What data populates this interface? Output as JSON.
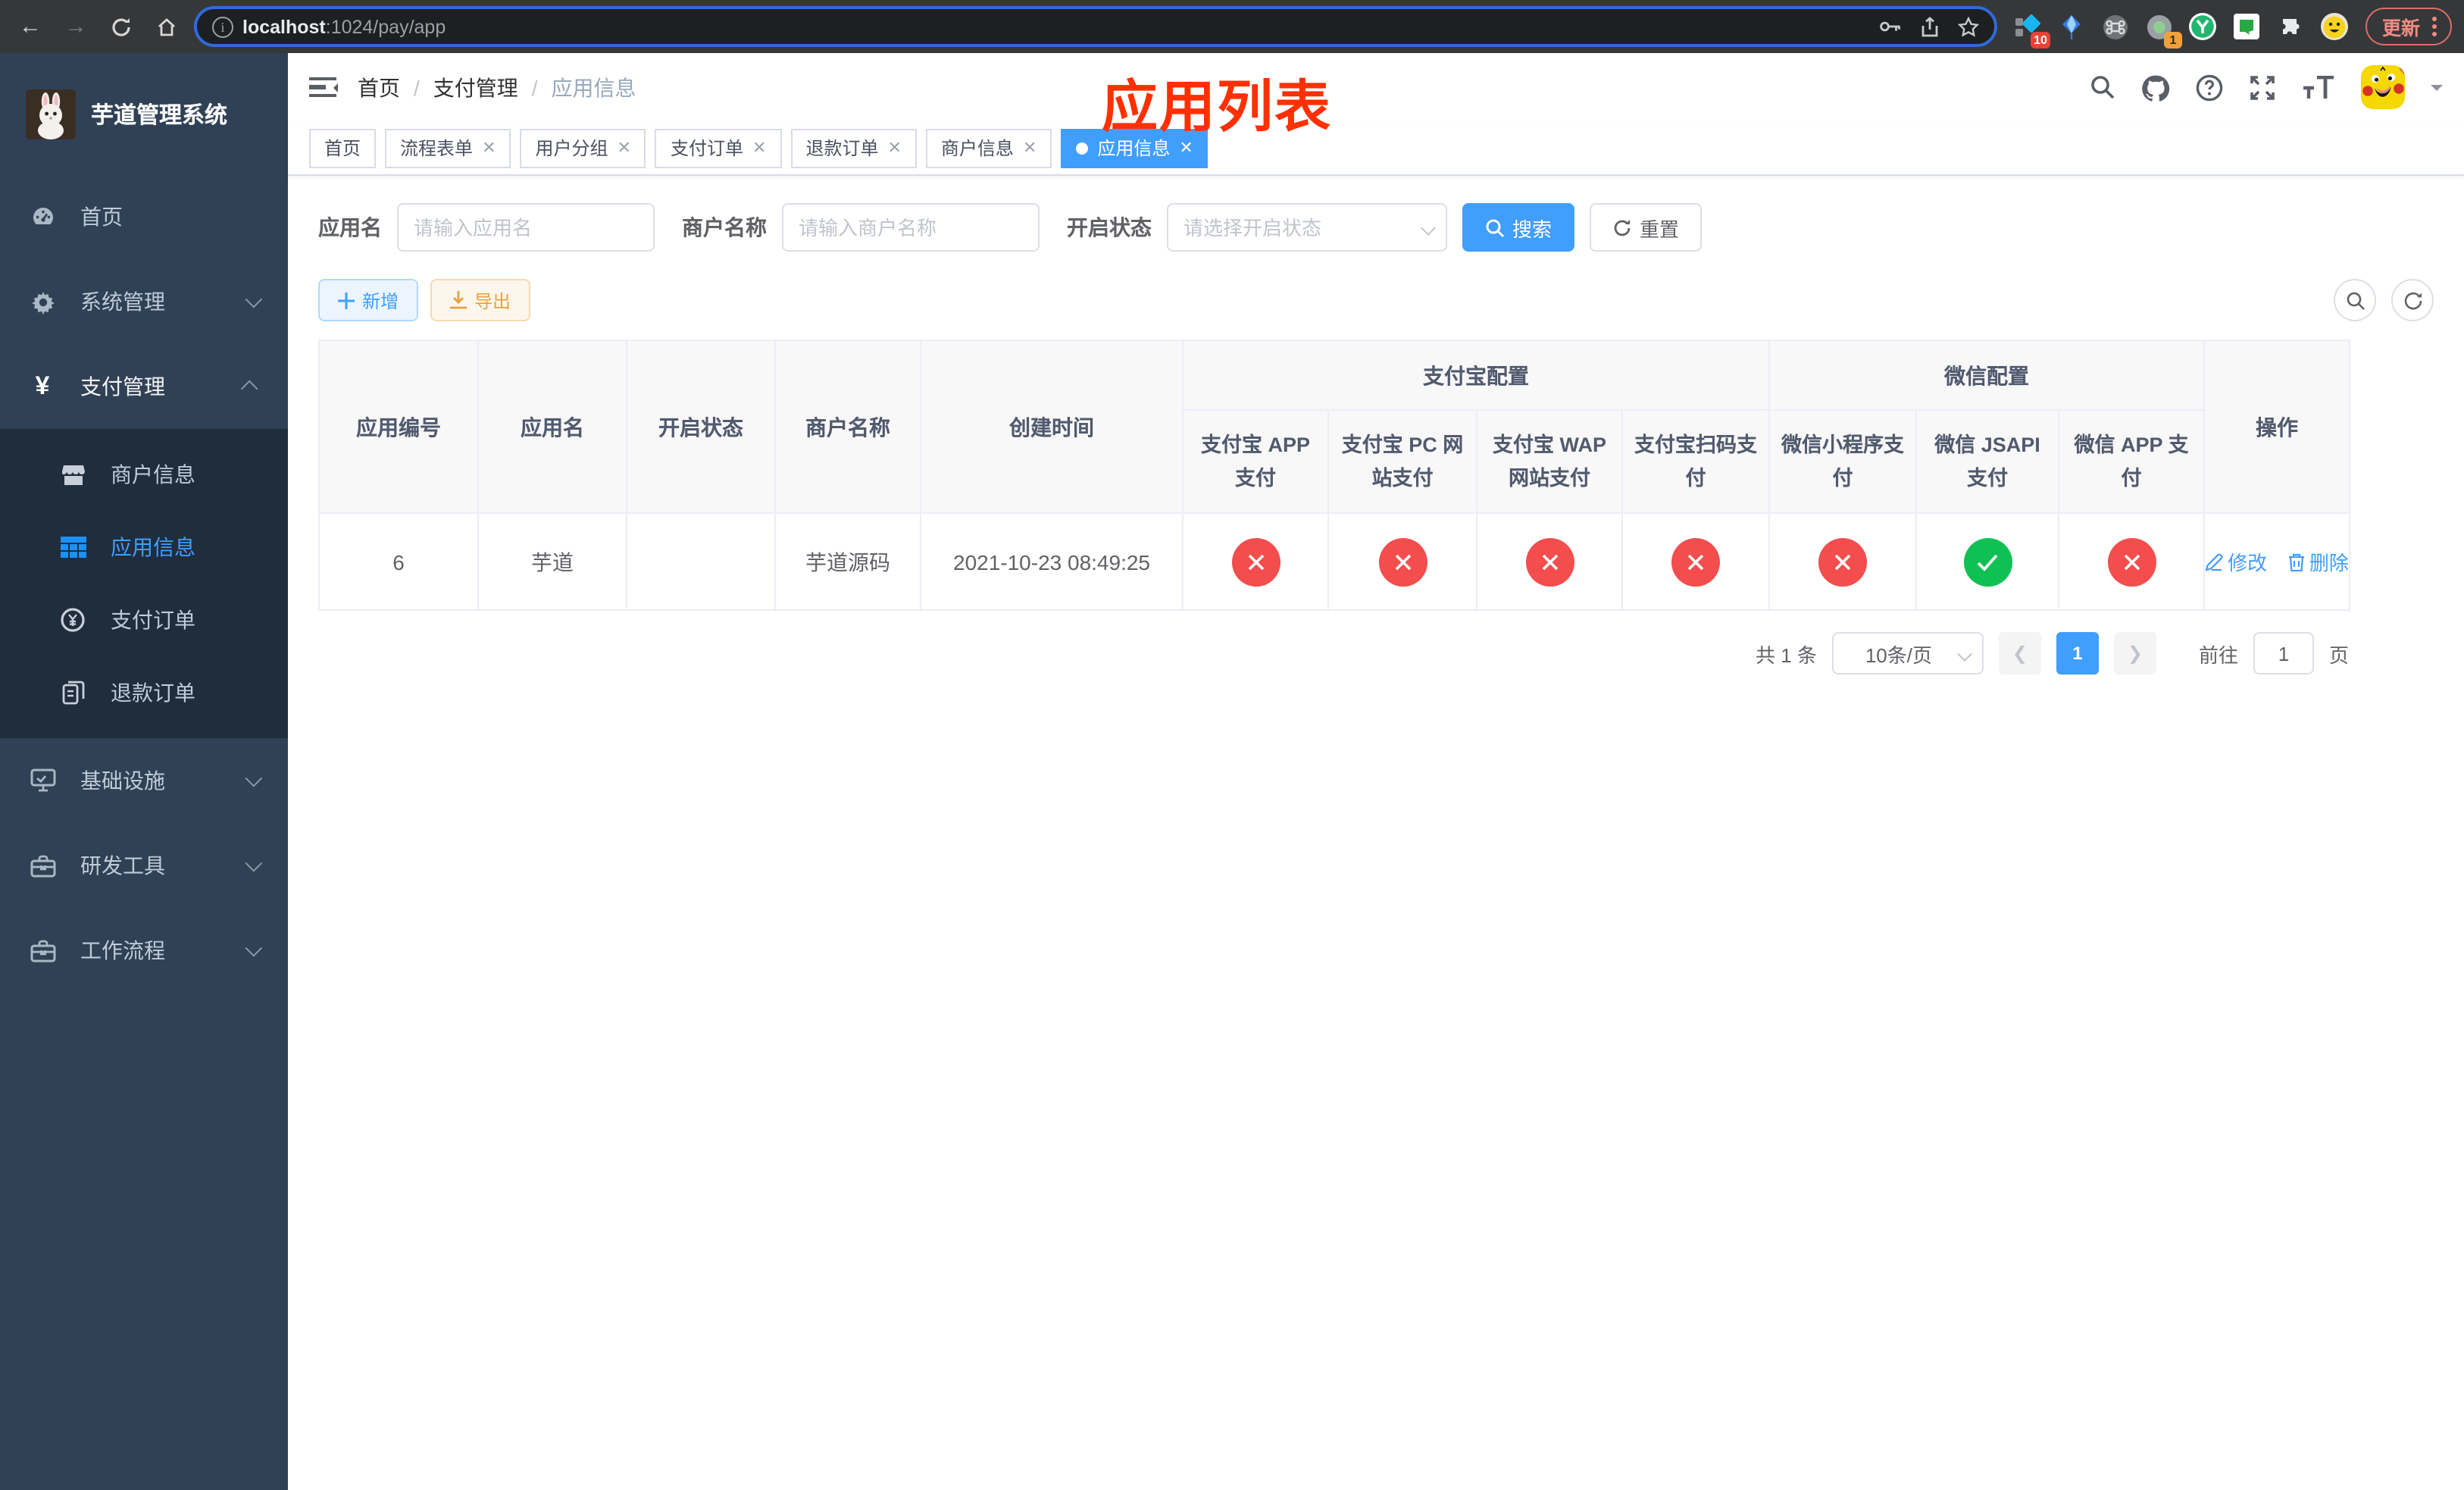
{
  "browser": {
    "url": {
      "host": "localhost",
      "path": ":1024/pay/app"
    },
    "update_button": "更新",
    "ext_badges": {
      "first": "10",
      "fourth": "1"
    }
  },
  "sidebar": {
    "title": "芋道管理系统",
    "menu": [
      {
        "label": "首页"
      },
      {
        "label": "系统管理"
      },
      {
        "label": "支付管理"
      }
    ],
    "submenu": [
      {
        "label": "商户信息"
      },
      {
        "label": "应用信息"
      },
      {
        "label": "支付订单"
      },
      {
        "label": "退款订单"
      }
    ],
    "menu2": [
      {
        "label": "基础设施"
      },
      {
        "label": "研发工具"
      },
      {
        "label": "工作流程"
      }
    ]
  },
  "header": {
    "breadcrumb": [
      "首页",
      "支付管理",
      "应用信息"
    ],
    "annotation": "应用列表"
  },
  "tags": [
    {
      "label": "首页"
    },
    {
      "label": "流程表单"
    },
    {
      "label": "用户分组"
    },
    {
      "label": "支付订单"
    },
    {
      "label": "退款订单"
    },
    {
      "label": "商户信息"
    },
    {
      "label": "应用信息"
    }
  ],
  "search": {
    "app_name": {
      "label": "应用名",
      "placeholder": "请输入应用名"
    },
    "merchant": {
      "label": "商户名称",
      "placeholder": "请输入商户名称"
    },
    "status": {
      "label": "开启状态",
      "placeholder": "请选择开启状态"
    },
    "search_button": "搜索",
    "reset_button": "重置"
  },
  "toolbar": {
    "add_button": "新增",
    "export_button": "导出"
  },
  "table": {
    "columns": [
      "应用编号",
      "应用名",
      "开启状态",
      "商户名称",
      "创建时间"
    ],
    "groups": [
      {
        "label": "支付宝配置",
        "columns": [
          "支付宝 APP 支付",
          "支付宝 PC 网站支付",
          "支付宝 WAP 网站支付",
          "支付宝扫码支付"
        ]
      },
      {
        "label": "微信配置",
        "columns": [
          "微信小程序支付",
          "微信 JSAPI 支付",
          "微信 APP 支付"
        ]
      }
    ],
    "action_column": "操作",
    "rows": [
      {
        "id": "6",
        "name": "芋道",
        "enabled": true,
        "merchant_name": "芋道源码",
        "create_time": "2021-10-23 08:49:25",
        "channel_status": [
          "fail",
          "fail",
          "fail",
          "fail",
          "fail",
          "success",
          "fail"
        ],
        "edit_label": "修改",
        "delete_label": "删除"
      }
    ]
  },
  "pagination": {
    "total": "共 1 条",
    "page_size": "10条/页",
    "current_page": "1",
    "goto_label": "前往",
    "goto_value": "1",
    "page_unit": "页"
  },
  "colors": {
    "accent": "#409eff",
    "success": "#0fc053",
    "danger": "#f34d4d",
    "warning": "#e6a23c"
  }
}
